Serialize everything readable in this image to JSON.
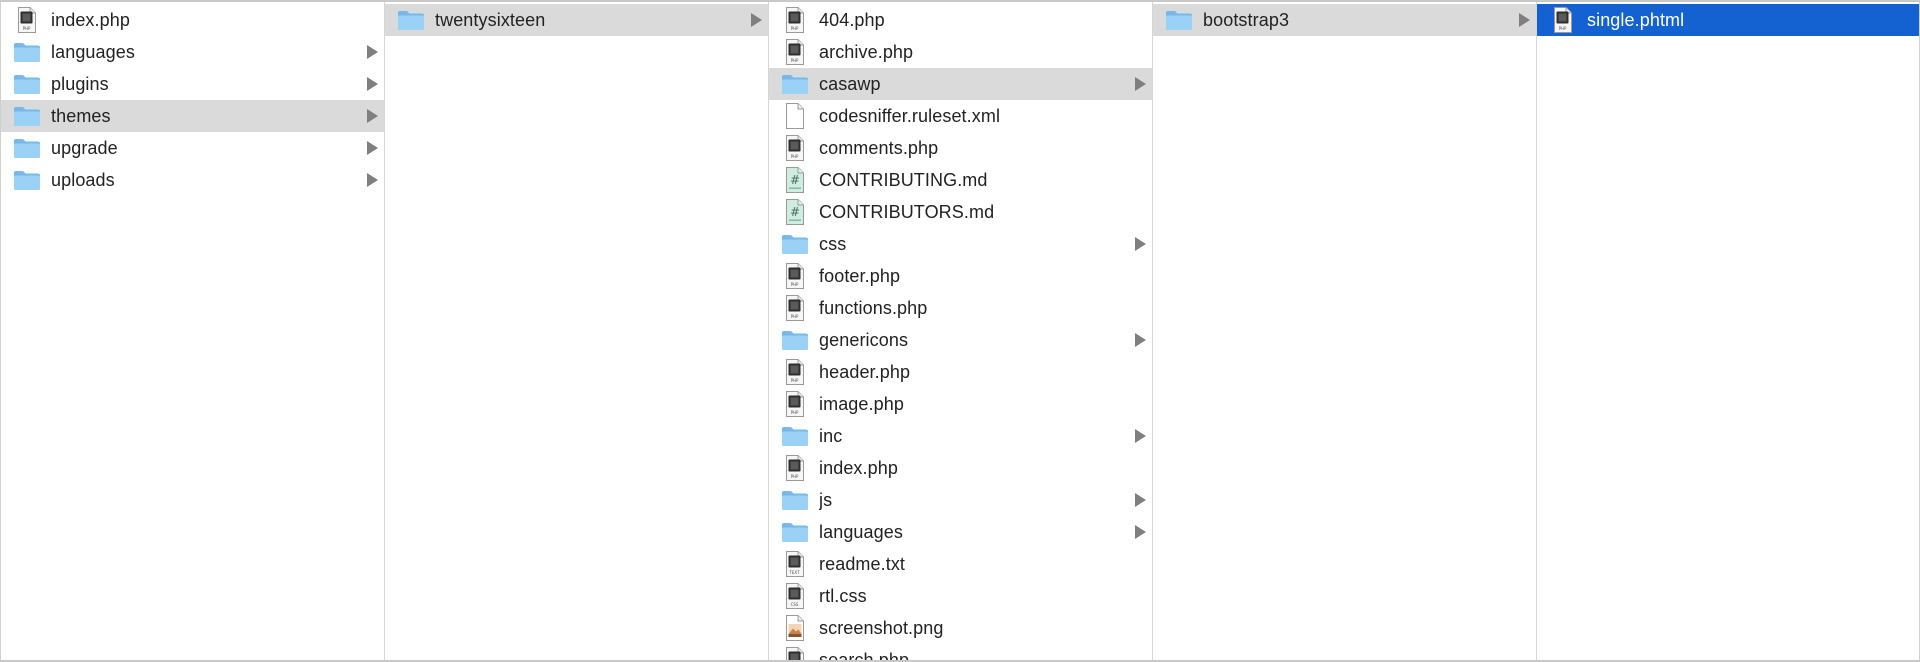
{
  "columns": [
    {
      "items": [
        {
          "name": "index.php",
          "type": "php",
          "expandable": false,
          "state": ""
        },
        {
          "name": "languages",
          "type": "folder",
          "expandable": true,
          "state": ""
        },
        {
          "name": "plugins",
          "type": "folder",
          "expandable": true,
          "state": ""
        },
        {
          "name": "themes",
          "type": "folder",
          "expandable": true,
          "state": "sel"
        },
        {
          "name": "upgrade",
          "type": "folder",
          "expandable": true,
          "state": ""
        },
        {
          "name": "uploads",
          "type": "folder",
          "expandable": true,
          "state": ""
        }
      ]
    },
    {
      "items": [
        {
          "name": "twentysixteen",
          "type": "folder",
          "expandable": true,
          "state": "sel"
        }
      ]
    },
    {
      "items": [
        {
          "name": "404.php",
          "type": "php",
          "expandable": false,
          "state": ""
        },
        {
          "name": "archive.php",
          "type": "php",
          "expandable": false,
          "state": ""
        },
        {
          "name": "casawp",
          "type": "folder",
          "expandable": true,
          "state": "sel"
        },
        {
          "name": "codesniffer.ruleset.xml",
          "type": "blank",
          "expandable": false,
          "state": ""
        },
        {
          "name": "comments.php",
          "type": "php",
          "expandable": false,
          "state": ""
        },
        {
          "name": "CONTRIBUTING.md",
          "type": "md",
          "expandable": false,
          "state": ""
        },
        {
          "name": "CONTRIBUTORS.md",
          "type": "md",
          "expandable": false,
          "state": ""
        },
        {
          "name": "css",
          "type": "folder",
          "expandable": true,
          "state": ""
        },
        {
          "name": "footer.php",
          "type": "php",
          "expandable": false,
          "state": ""
        },
        {
          "name": "functions.php",
          "type": "php",
          "expandable": false,
          "state": ""
        },
        {
          "name": "genericons",
          "type": "folder",
          "expandable": true,
          "state": ""
        },
        {
          "name": "header.php",
          "type": "php",
          "expandable": false,
          "state": ""
        },
        {
          "name": "image.php",
          "type": "php",
          "expandable": false,
          "state": ""
        },
        {
          "name": "inc",
          "type": "folder",
          "expandable": true,
          "state": ""
        },
        {
          "name": "index.php",
          "type": "php",
          "expandable": false,
          "state": ""
        },
        {
          "name": "js",
          "type": "folder",
          "expandable": true,
          "state": ""
        },
        {
          "name": "languages",
          "type": "folder",
          "expandable": true,
          "state": ""
        },
        {
          "name": "readme.txt",
          "type": "txt",
          "expandable": false,
          "state": ""
        },
        {
          "name": "rtl.css",
          "type": "cssfile",
          "expandable": false,
          "state": ""
        },
        {
          "name": "screenshot.png",
          "type": "png",
          "expandable": false,
          "state": ""
        },
        {
          "name": "search.php",
          "type": "php",
          "expandable": false,
          "state": ""
        }
      ]
    },
    {
      "items": [
        {
          "name": "bootstrap3",
          "type": "folder",
          "expandable": true,
          "state": "sel"
        }
      ]
    },
    {
      "items": [
        {
          "name": "single.phtml",
          "type": "php",
          "expandable": false,
          "state": "active"
        }
      ]
    }
  ],
  "icon_names": {
    "folder": "folder-icon",
    "php": "php-file-icon",
    "blank": "blank-document-icon",
    "md": "markdown-file-icon",
    "txt": "text-file-icon",
    "cssfile": "css-file-icon",
    "png": "image-file-icon"
  },
  "file_badges": {
    "php": "PHP",
    "txt": "TEXT",
    "cssfile": "CSS"
  },
  "colors": {
    "folder_back": "#74b8ec",
    "folder_front": "#9bd1f7",
    "selection_inactive": "#dadada",
    "selection_active": "#1461d2",
    "markdown_tint": "#cfece0"
  }
}
